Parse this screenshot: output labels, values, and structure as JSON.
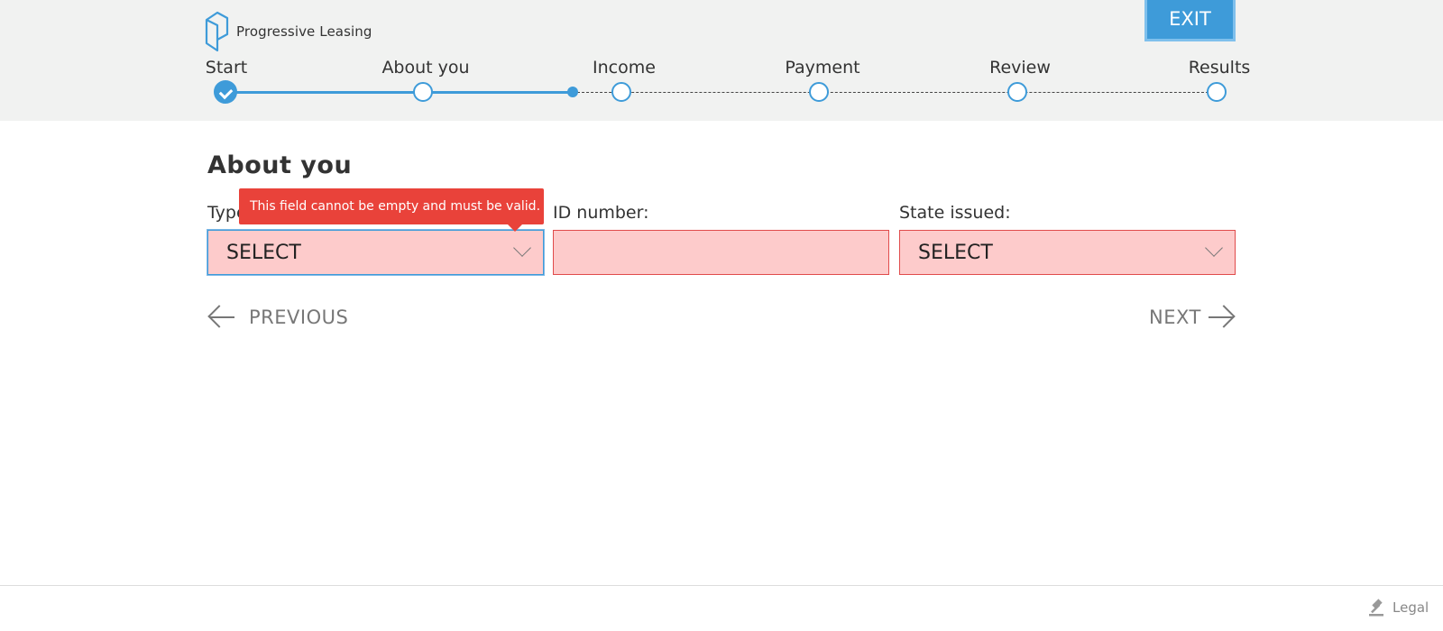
{
  "header": {
    "brand": "Progressive Leasing",
    "exit_label": "EXIT",
    "accent_color": "#3e9bd9"
  },
  "steps": [
    {
      "label": "Start",
      "state": "complete"
    },
    {
      "label": "About you",
      "state": "current"
    },
    {
      "label": "Income",
      "state": "upcoming"
    },
    {
      "label": "Payment",
      "state": "upcoming"
    },
    {
      "label": "Review",
      "state": "upcoming"
    },
    {
      "label": "Results",
      "state": "upcoming"
    }
  ],
  "main": {
    "title": "About you",
    "tooltip": "This field cannot be empty and must be valid.",
    "fields": {
      "type": {
        "label": "Type",
        "value": "SELECT"
      },
      "id_number": {
        "label": "ID number:",
        "value": ""
      },
      "state_issued": {
        "label": "State issued:",
        "value": "SELECT"
      }
    },
    "previous_label": "PREVIOUS",
    "next_label": "NEXT"
  },
  "footer": {
    "legal_label": "Legal",
    "icon": "gavel-icon"
  }
}
